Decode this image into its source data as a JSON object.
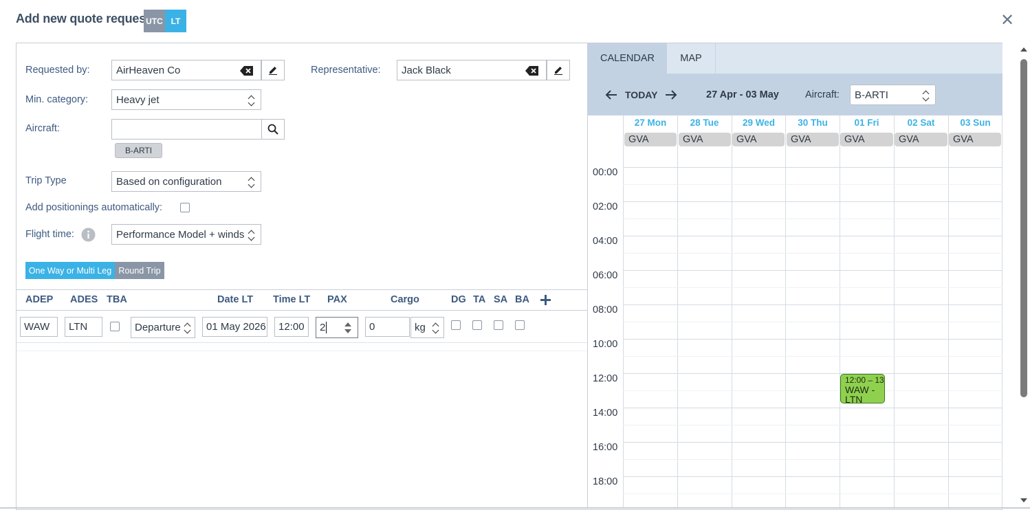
{
  "header": {
    "title": "Add new quote request",
    "tz_utc": "UTC",
    "tz_lt": "LT",
    "close_icon": "close-icon"
  },
  "form": {
    "requested_by_label": "Requested by:",
    "requested_by_value": "AirHeaven Co",
    "representative_label": "Representative:",
    "representative_value": "Jack Black",
    "min_category_label": "Min. category:",
    "min_category_value": "Heavy jet",
    "aircraft_label": "Aircraft:",
    "aircraft_value": "",
    "aircraft_chip": "B-ARTI",
    "trip_type_label": "Trip Type",
    "trip_type_value": "Based on configuration",
    "add_positionings_label": "Add positionings automatically:",
    "flight_time_label": "Flight time:",
    "flight_time_value": "Performance Model + winds"
  },
  "trip_toggle": {
    "one_way": "One Way or Multi Leg",
    "round_trip": "Round Trip"
  },
  "legs_table": {
    "headers": [
      "ADEP",
      "ADES",
      "TBA",
      "Date LT",
      "Time LT",
      "PAX",
      "Cargo",
      "DG",
      "TA",
      "SA",
      "BA"
    ],
    "add_icon": "plus-icon",
    "row": {
      "adep": "WAW",
      "ades": "LTN",
      "dep_type": "Departure",
      "date": "01 May 2026",
      "time": "12:00",
      "pax": "2",
      "cargo": "0",
      "cargo_unit": "kg"
    }
  },
  "calendar": {
    "tabs": [
      "CALENDAR",
      "MAP"
    ],
    "today": "TODAY",
    "range": "27 Apr - 03 May",
    "aircraft_label": "Aircraft:",
    "aircraft_value": "B-ARTI",
    "days": [
      "27 Mon",
      "28 Tue",
      "29 Wed",
      "30 Thu",
      "01 Fri",
      "02 Sat",
      "03 Sun"
    ],
    "day_base": "GVA",
    "hours": [
      "00:00",
      "02:00",
      "04:00",
      "06:00",
      "08:00",
      "10:00",
      "12:00",
      "14:00",
      "16:00",
      "18:00"
    ],
    "event": {
      "time": "12:00 – 13",
      "route": "WAW - LTN",
      "color": "#8fd14f"
    }
  },
  "colors": {
    "accent": "#3bb2e6",
    "muted": "#8a96a6",
    "label": "#3d5a80"
  }
}
